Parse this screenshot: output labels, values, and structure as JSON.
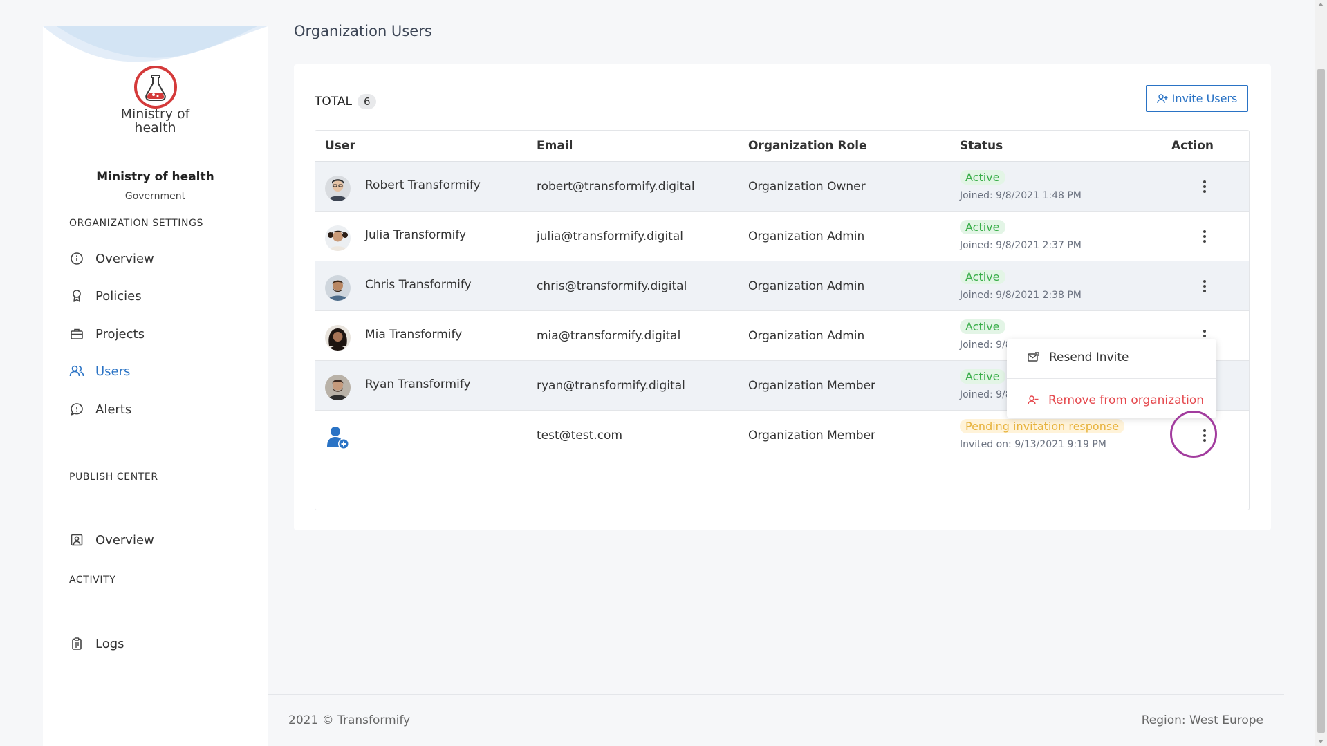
{
  "sidebar": {
    "logo_text_line1": "Ministry of",
    "logo_text_line2": "health",
    "org_name": "Ministry of health",
    "org_type": "Government",
    "sections": [
      {
        "title": "ORGANIZATION SETTINGS"
      },
      {
        "title": "PUBLISH CENTER"
      },
      {
        "title": "ACTIVITY"
      }
    ],
    "items": [
      {
        "label": "Overview",
        "icon": "info-icon"
      },
      {
        "label": "Policies",
        "icon": "badge-icon"
      },
      {
        "label": "Projects",
        "icon": "briefcase-icon"
      },
      {
        "label": "Users",
        "icon": "users-icon",
        "active": true
      },
      {
        "label": "Alerts",
        "icon": "alert-bubble-icon"
      },
      {
        "label": "Overview",
        "icon": "portrait-icon"
      },
      {
        "label": "Logs",
        "icon": "clipboard-icon"
      }
    ]
  },
  "page": {
    "title": "Organization Users",
    "total_label": "TOTAL",
    "total_count": "6",
    "invite_label": "Invite Users"
  },
  "table": {
    "headers": [
      "User",
      "Email",
      "Organization Role",
      "Status",
      "Action"
    ],
    "rows": [
      {
        "name": "Robert Transformify",
        "email": "robert@transformify.digital",
        "role": "Organization Owner",
        "status": "Active",
        "sub": "Joined: 9/8/2021 1:48 PM"
      },
      {
        "name": "Julia Transformify",
        "email": "julia@transformify.digital",
        "role": "Organization Admin",
        "status": "Active",
        "sub": "Joined: 9/8/2021 2:37 PM"
      },
      {
        "name": "Chris Transformify",
        "email": "chris@transformify.digital",
        "role": "Organization Admin",
        "status": "Active",
        "sub": "Joined: 9/8/2021 2:38 PM"
      },
      {
        "name": "Mia Transformify",
        "email": "mia@transformify.digital",
        "role": "Organization Admin",
        "status": "Active",
        "sub": "Joined: 9/8"
      },
      {
        "name": "Ryan Transformify",
        "email": "ryan@transformify.digital",
        "role": "Organization Member",
        "status": "Active",
        "sub": "Joined: 9/8"
      },
      {
        "name": "",
        "email": "test@test.com",
        "role": "Organization Member",
        "status": "Pending invitation response",
        "sub": "Invited on: 9/13/2021 9:19 PM"
      }
    ]
  },
  "dropdown": {
    "resend": "Resend Invite",
    "remove": "Remove from organization"
  },
  "footer": {
    "copyright": "2021 © Transformify",
    "region": "Region: West Europe"
  },
  "colors": {
    "accent": "#2a73c5",
    "active": "#3aae4a",
    "pending": "#e7b33e",
    "danger": "#e5484d"
  }
}
